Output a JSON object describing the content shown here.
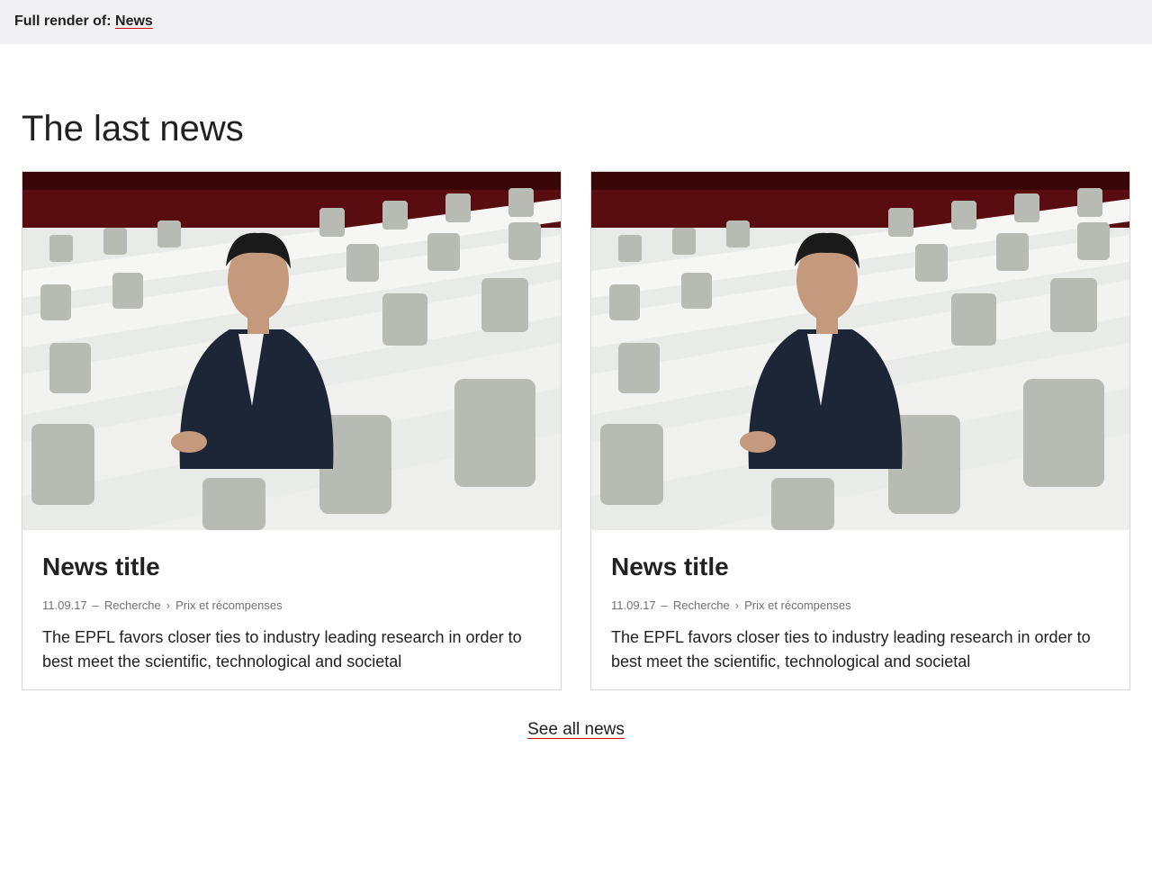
{
  "topbar": {
    "prefix": "Full render of:",
    "link_label": "News"
  },
  "section": {
    "title": "The last news"
  },
  "cards": [
    {
      "title": "News title",
      "date": "11.09.17",
      "date_sep": "–",
      "category": "Recherche",
      "category_sep": "›",
      "subcategory": "Prix et récompenses",
      "excerpt": "The EPFL favors closer ties to industry leading research in order to best meet the scientific, technological and societal"
    },
    {
      "title": "News title",
      "date": "11.09.17",
      "date_sep": "–",
      "category": "Recherche",
      "category_sep": "›",
      "subcategory": "Prix et récompenses",
      "excerpt": "The EPFL favors closer ties to industry leading research in order to best meet the scientific, technological and societal"
    }
  ],
  "footer": {
    "see_all_label": "See all news"
  },
  "colors": {
    "accent": "#cc0000",
    "topbar_bg": "#f1f1f3",
    "text": "#212121",
    "meta": "#707070"
  }
}
